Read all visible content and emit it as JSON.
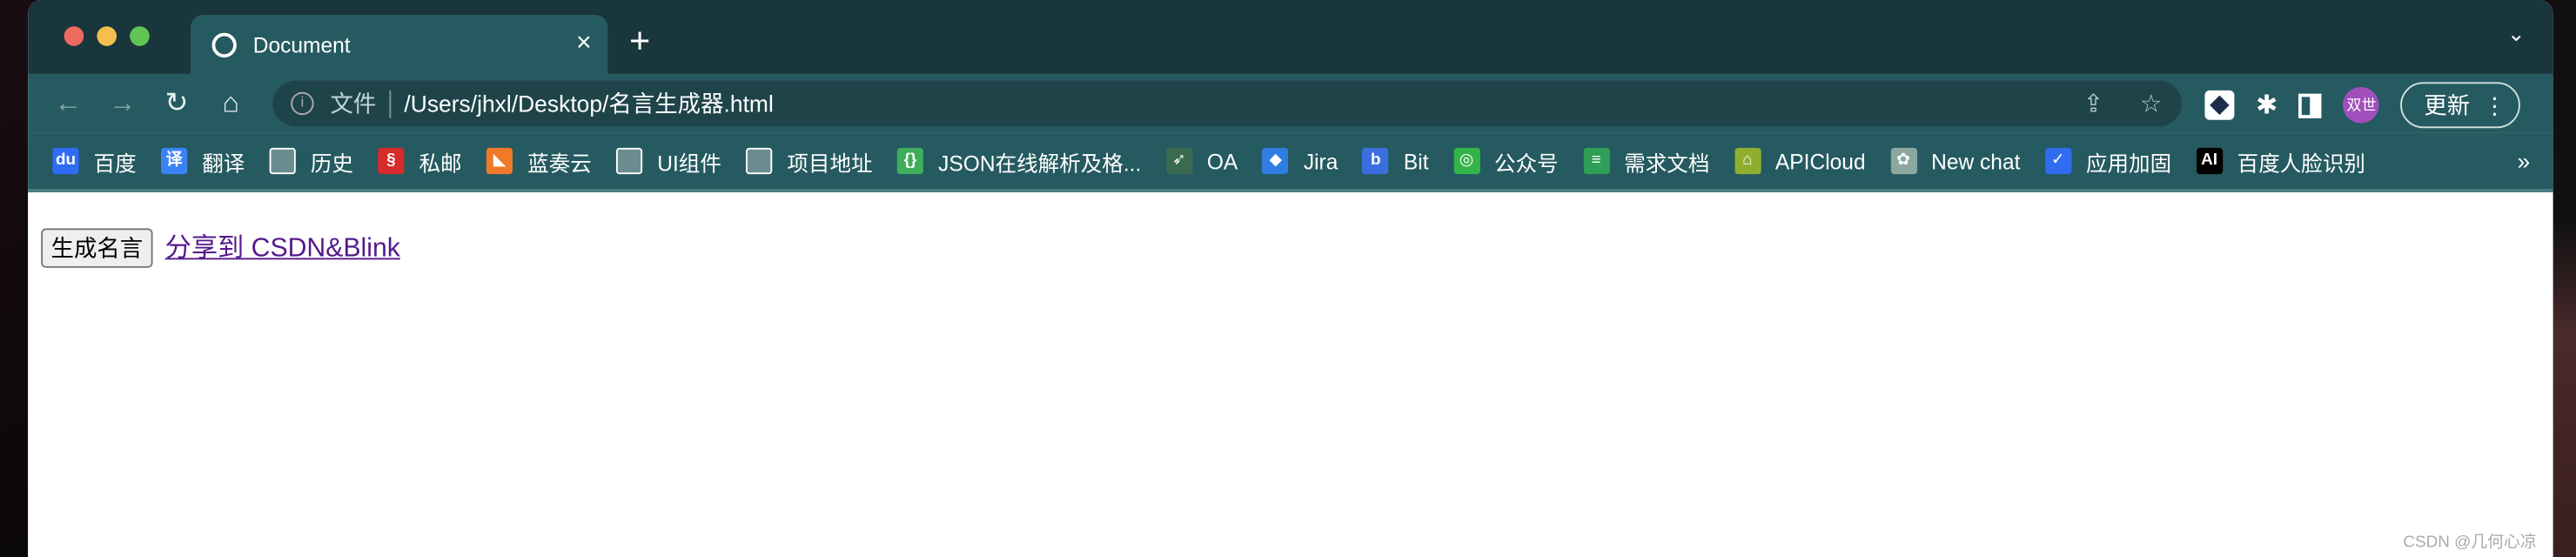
{
  "tab": {
    "title": "Document",
    "close": "×",
    "new_tab": "+",
    "tab_menu": "⌄"
  },
  "toolbar": {
    "back": "←",
    "forward": "→",
    "reload": "↻",
    "home": "⌂",
    "scheme_label": "文件",
    "url": "/Users/jhxl/Desktop/名言生成器.html",
    "share_icon": "⇪",
    "star_icon": "☆",
    "puzzle_icon": "✱",
    "avatar_text": "双世",
    "update_label": "更新",
    "menu_icon": "⋮"
  },
  "bookmarks": [
    {
      "label": "百度",
      "icon": "baidu",
      "color": "#2f6cf6",
      "glyph": "du"
    },
    {
      "label": "翻译",
      "icon": "translate",
      "color": "#3b82f6",
      "glyph": "译"
    },
    {
      "label": "历史",
      "icon": "folder"
    },
    {
      "label": "私邮",
      "icon": "mail",
      "color": "#d62b2b",
      "glyph": "§"
    },
    {
      "label": "蓝奏云",
      "icon": "lanzou",
      "color": "#f07a2a",
      "glyph": "◣"
    },
    {
      "label": "UI组件",
      "icon": "folder"
    },
    {
      "label": "项目地址",
      "icon": "folder"
    },
    {
      "label": "JSON在线解析及格...",
      "icon": "json",
      "color": "#3fae5a",
      "glyph": "{}"
    },
    {
      "label": "OA",
      "icon": "oa",
      "color": "#3a6a50",
      "glyph": "➶"
    },
    {
      "label": "Jira",
      "icon": "jira",
      "color": "#2f7de1",
      "glyph": "◆"
    },
    {
      "label": "Bit",
      "icon": "bit",
      "color": "#3b6fe0",
      "glyph": "b"
    },
    {
      "label": "公众号",
      "icon": "wechat",
      "color": "#34b34a",
      "glyph": "◎"
    },
    {
      "label": "需求文档",
      "icon": "sheet",
      "color": "#2f9e56",
      "glyph": "≡"
    },
    {
      "label": "APICloud",
      "icon": "apicloud",
      "color": "#8fae2e",
      "glyph": "⌂"
    },
    {
      "label": "New chat",
      "icon": "openai",
      "color": "#8aa89e",
      "glyph": "✿"
    },
    {
      "label": "应用加固",
      "icon": "shield",
      "color": "#2f6cf0",
      "glyph": "✓"
    },
    {
      "label": "百度人脸识别",
      "icon": "ai",
      "color": "#000000",
      "glyph": "AI"
    }
  ],
  "bookmarks_more": "»",
  "page": {
    "button_label": "生成名言",
    "link_label": "分享到 CSDN&Blink"
  },
  "watermark": "CSDN @几何心凉",
  "colors": {
    "tabstrip": "#18363b",
    "toolbar": "#255a60",
    "link": "#551a8b"
  }
}
